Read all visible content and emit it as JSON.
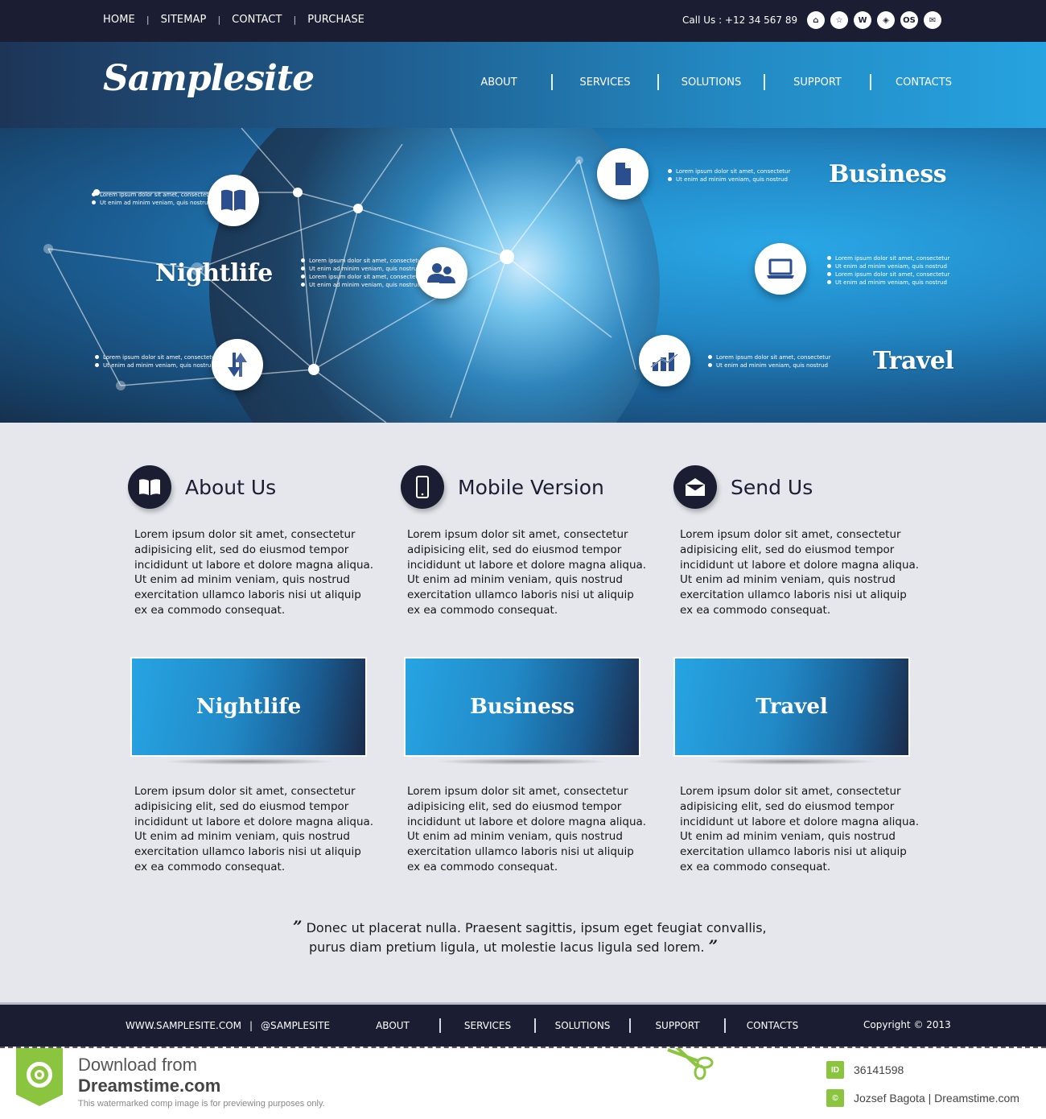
{
  "topbar": {
    "nav": [
      "HOME",
      "SITEMAP",
      "CONTACT",
      "PURCHASE"
    ],
    "call_us": "Call Us : +12 34 567 89",
    "social_icons": [
      {
        "name": "home-icon",
        "glyph": "⌂"
      },
      {
        "name": "star-icon",
        "glyph": "☆"
      },
      {
        "name": "w-icon",
        "glyph": "W"
      },
      {
        "name": "compass-icon",
        "glyph": "◈"
      },
      {
        "name": "os-icon",
        "glyph": "OS"
      },
      {
        "name": "mail-icon",
        "glyph": "✉"
      }
    ]
  },
  "header": {
    "logo": "Samplesite",
    "nav": [
      "ABOUT",
      "SERVICES",
      "SOLUTIONS",
      "SUPPORT",
      "CONTACTS"
    ]
  },
  "hero": {
    "titles": {
      "nightlife": "Nightlife",
      "business": "Business",
      "travel": "Travel"
    },
    "bullet_a": "Lorem ipsum dolor sit amet, consectetur",
    "bullet_b": "Ut enim ad minim veniam, quis nostrud",
    "icons": [
      "book-icon",
      "users-icon",
      "transfer-icon",
      "document-icon",
      "laptop-icon",
      "chart-icon"
    ]
  },
  "features": [
    {
      "title": "About Us",
      "icon": "book-icon"
    },
    {
      "title": "Mobile Version",
      "icon": "mobile-icon"
    },
    {
      "title": "Send Us",
      "icon": "envelope-icon"
    }
  ],
  "paragraph": "Lorem ipsum dolor sit amet, consectetur adipisicing elit, sed do eiusmod tempor incididunt ut labore et dolore magna aliqua. Ut enim ad minim veniam, quis nostrud exercitation ullamco laboris nisi ut aliquip ex ea commodo consequat.",
  "banners": [
    "Nightlife",
    "Business",
    "Travel"
  ],
  "quote": {
    "line1": "Donec ut placerat nulla. Praesent sagittis, ipsum eget feugiat convallis,",
    "line2": "purus diam pretium ligula, ut molestie lacus ligula sed lorem.",
    "open": "”",
    "close": "”"
  },
  "footer": {
    "website": "WWW.SAMPLESITE.COM",
    "separator": "|",
    "handle": "@SAMPLESITE",
    "nav": [
      "ABOUT",
      "SERVICES",
      "SOLUTIONS",
      "SUPPORT",
      "CONTACTS"
    ],
    "copyright": "Copyright © 2013"
  },
  "watermark": {
    "line1": "Download from",
    "line2": "Dreamstime.com",
    "line3": "This watermarked comp image is for previewing purposes only.",
    "id_badge": "ID",
    "id": "36141598",
    "credit_badge": "©",
    "credit": "Jozsef Bagota | Dreamstime.com"
  },
  "colors": {
    "dark_navy": "#1b1d32",
    "bright_blue": "#26a3e0",
    "icon_blue": "#2b4e8f",
    "content_bg": "#e6e7ec",
    "dreamstime_green": "#8bc53f"
  }
}
